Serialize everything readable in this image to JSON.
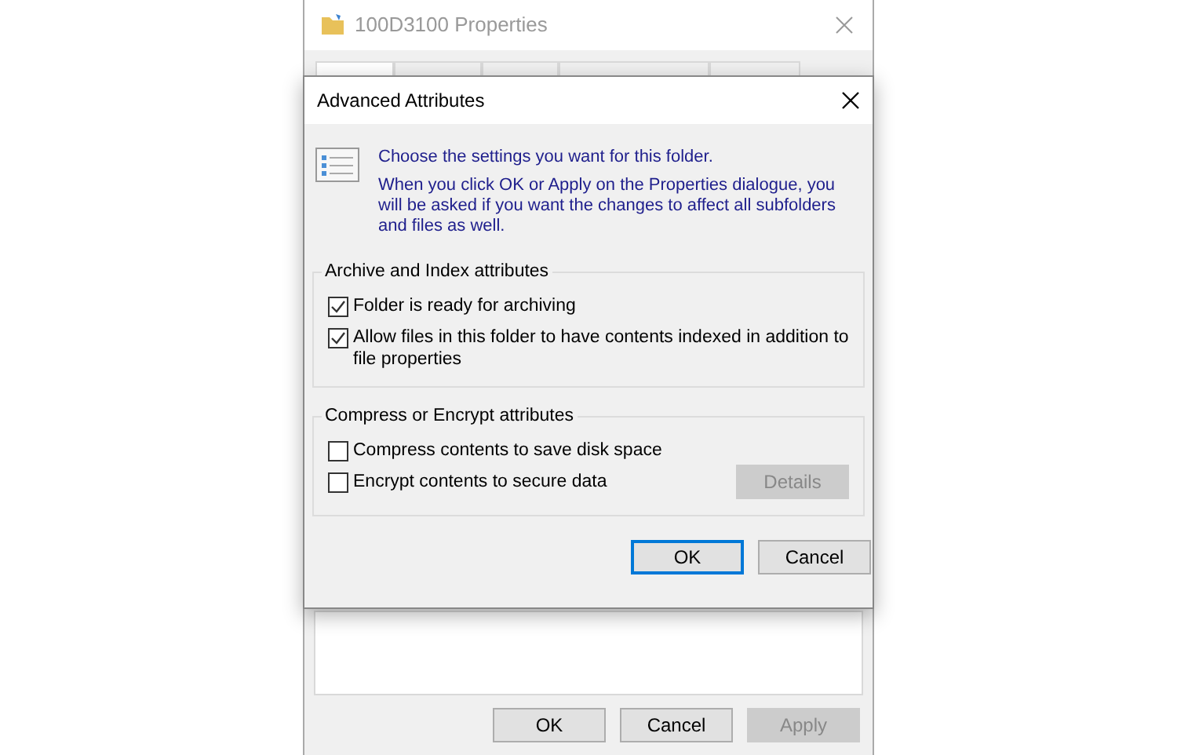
{
  "properties_window": {
    "title": "100D3100 Properties",
    "tabs": [
      {
        "selected": true
      },
      {
        "selected": false
      },
      {
        "selected": false
      },
      {
        "selected": false
      },
      {
        "selected": false
      }
    ],
    "buttons": [
      {
        "label": "OK",
        "disabled": false
      },
      {
        "label": "Cancel",
        "disabled": false
      },
      {
        "label": "Apply",
        "disabled": true
      }
    ]
  },
  "dialog": {
    "title": "Advanced Attributes",
    "intro": "Choose the settings you want for this folder.",
    "note": "When you click OK or Apply on the Properties dialogue, you will be asked if you want the changes to affect all subfolders and files as well.",
    "groups": [
      {
        "title": "Archive and Index attributes",
        "options": [
          {
            "label": "Folder is ready for archiving",
            "checked": true
          },
          {
            "label": "Allow files in this folder to have contents indexed in addition to file properties",
            "checked": true
          }
        ]
      },
      {
        "title": "Compress or Encrypt attributes",
        "options": [
          {
            "label": "Compress contents to save disk space",
            "checked": false
          },
          {
            "label": "Encrypt contents to secure data",
            "checked": false
          }
        ],
        "button": {
          "label": "Details",
          "disabled": true
        }
      }
    ],
    "buttons": [
      {
        "label": "OK",
        "default": true
      },
      {
        "label": "Cancel",
        "default": false
      }
    ]
  }
}
